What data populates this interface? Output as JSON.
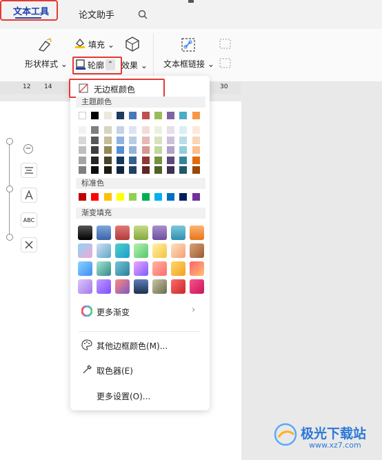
{
  "tabs": {
    "text_tools": "文本工具",
    "paper_assistant": "论文助手"
  },
  "ribbon": {
    "shape_style": "形状样式",
    "fill": "填充",
    "outline": "轮廓",
    "effect": "效果",
    "text_box_link": "文本框链接"
  },
  "ruler": {
    "ticks": [
      "12",
      "14",
      "30"
    ]
  },
  "menu": {
    "no_border": "无边框颜色",
    "theme_colors": "主题颜色",
    "standard_colors": "标准色",
    "gradient_fill": "渐变填充",
    "more_gradient": "更多渐变",
    "other_border": "其他边框颜色(M)...",
    "eyedropper": "取色器(E)",
    "more_settings": "更多设置(O)...",
    "theme_top": [
      "#ffffff",
      "#000000",
      "#ebe8dc",
      "#1f3a5f",
      "#4a77b8",
      "#c0504d",
      "#9bbb59",
      "#8064a2",
      "#4bacc6",
      "#f79646"
    ],
    "theme_shades": [
      [
        "#f2f2f2",
        "#7f7f7f",
        "#d8d4c0",
        "#c5d2e8",
        "#dbe5f2",
        "#f2dcdb",
        "#ebf1dd",
        "#e5e0ec",
        "#dbeef3",
        "#fde9d9"
      ],
      [
        "#d8d8d8",
        "#595959",
        "#c4bd97",
        "#8db3e2",
        "#b8cce4",
        "#e5b9b7",
        "#d7e3bc",
        "#ccc1d9",
        "#b7dde8",
        "#fbd5b5"
      ],
      [
        "#bfbfbf",
        "#3f3f3f",
        "#938953",
        "#548dd4",
        "#95b3d7",
        "#d99694",
        "#c3d69b",
        "#b2a2c7",
        "#92cddc",
        "#fac08f"
      ],
      [
        "#a5a5a5",
        "#262626",
        "#494429",
        "#17365d",
        "#366092",
        "#953734",
        "#76923c",
        "#5f497a",
        "#31859b",
        "#e36c09"
      ],
      [
        "#7f7f7f",
        "#0c0c0c",
        "#1d1b10",
        "#0f243e",
        "#244061",
        "#632423",
        "#4f6128",
        "#3f3151",
        "#205867",
        "#974806"
      ]
    ],
    "standard": [
      "#c00000",
      "#ff0000",
      "#ffc000",
      "#ffff00",
      "#92d050",
      "#00b050",
      "#00b0f0",
      "#0070c0",
      "#002060",
      "#7030a0"
    ],
    "gradients": [
      [
        "linear-gradient(#555,#000)",
        "linear-gradient(#7ea6dd,#3a64a8)",
        "linear-gradient(#e07a78,#b23a38)",
        "linear-gradient(#c5dc8a,#86a63e)",
        "linear-gradient(#a98fcf,#6f4e9c)",
        "linear-gradient(#7cc8dd,#2f8fb0)",
        "linear-gradient(#fbb572,#e8741a)"
      ],
      [
        "linear-gradient(135deg,#8fd3f4,#f3a7d7)",
        "linear-gradient(135deg,#d6e0f5,#5aa8c8)",
        "linear-gradient(135deg,#4fd1c5,#1f9bd1)",
        "linear-gradient(135deg,#b7f0b1,#54c86a)",
        "linear-gradient(135deg,#fff1a8,#f5c342)",
        "linear-gradient(135deg,#fde2c4,#f4a071)",
        "linear-gradient(135deg,#d9a57a,#9b5a2e)"
      ],
      [
        "linear-gradient(135deg,#89d4ff,#3d8ef0)",
        "linear-gradient(135deg,#a8e6cf,#2e8b8b)",
        "linear-gradient(135deg,#74c7d4,#2b7f9e)",
        "linear-gradient(135deg,#f0a6ff,#7a5cff)",
        "linear-gradient(135deg,#ffb6a0,#ff6b6b)",
        "linear-gradient(135deg,#ffd86b,#f0a020)",
        "linear-gradient(135deg,#ff5f6d,#ffc371)"
      ],
      [
        "linear-gradient(135deg,#e0c3fc,#9f7bea)",
        "linear-gradient(135deg,#c39bff,#7c4dff)",
        "linear-gradient(135deg,#ff8a80,#7e57c2)",
        "linear-gradient(#5d7db8,#1f3050)",
        "linear-gradient(135deg,#c9c6a4,#6b6a4e)",
        "linear-gradient(135deg,#ff6a6a,#c62828)",
        "linear-gradient(135deg,#ff4f8b,#c2185b)"
      ]
    ]
  },
  "watermark": {
    "name": "极光下载站",
    "url": "www.xz7.com"
  }
}
